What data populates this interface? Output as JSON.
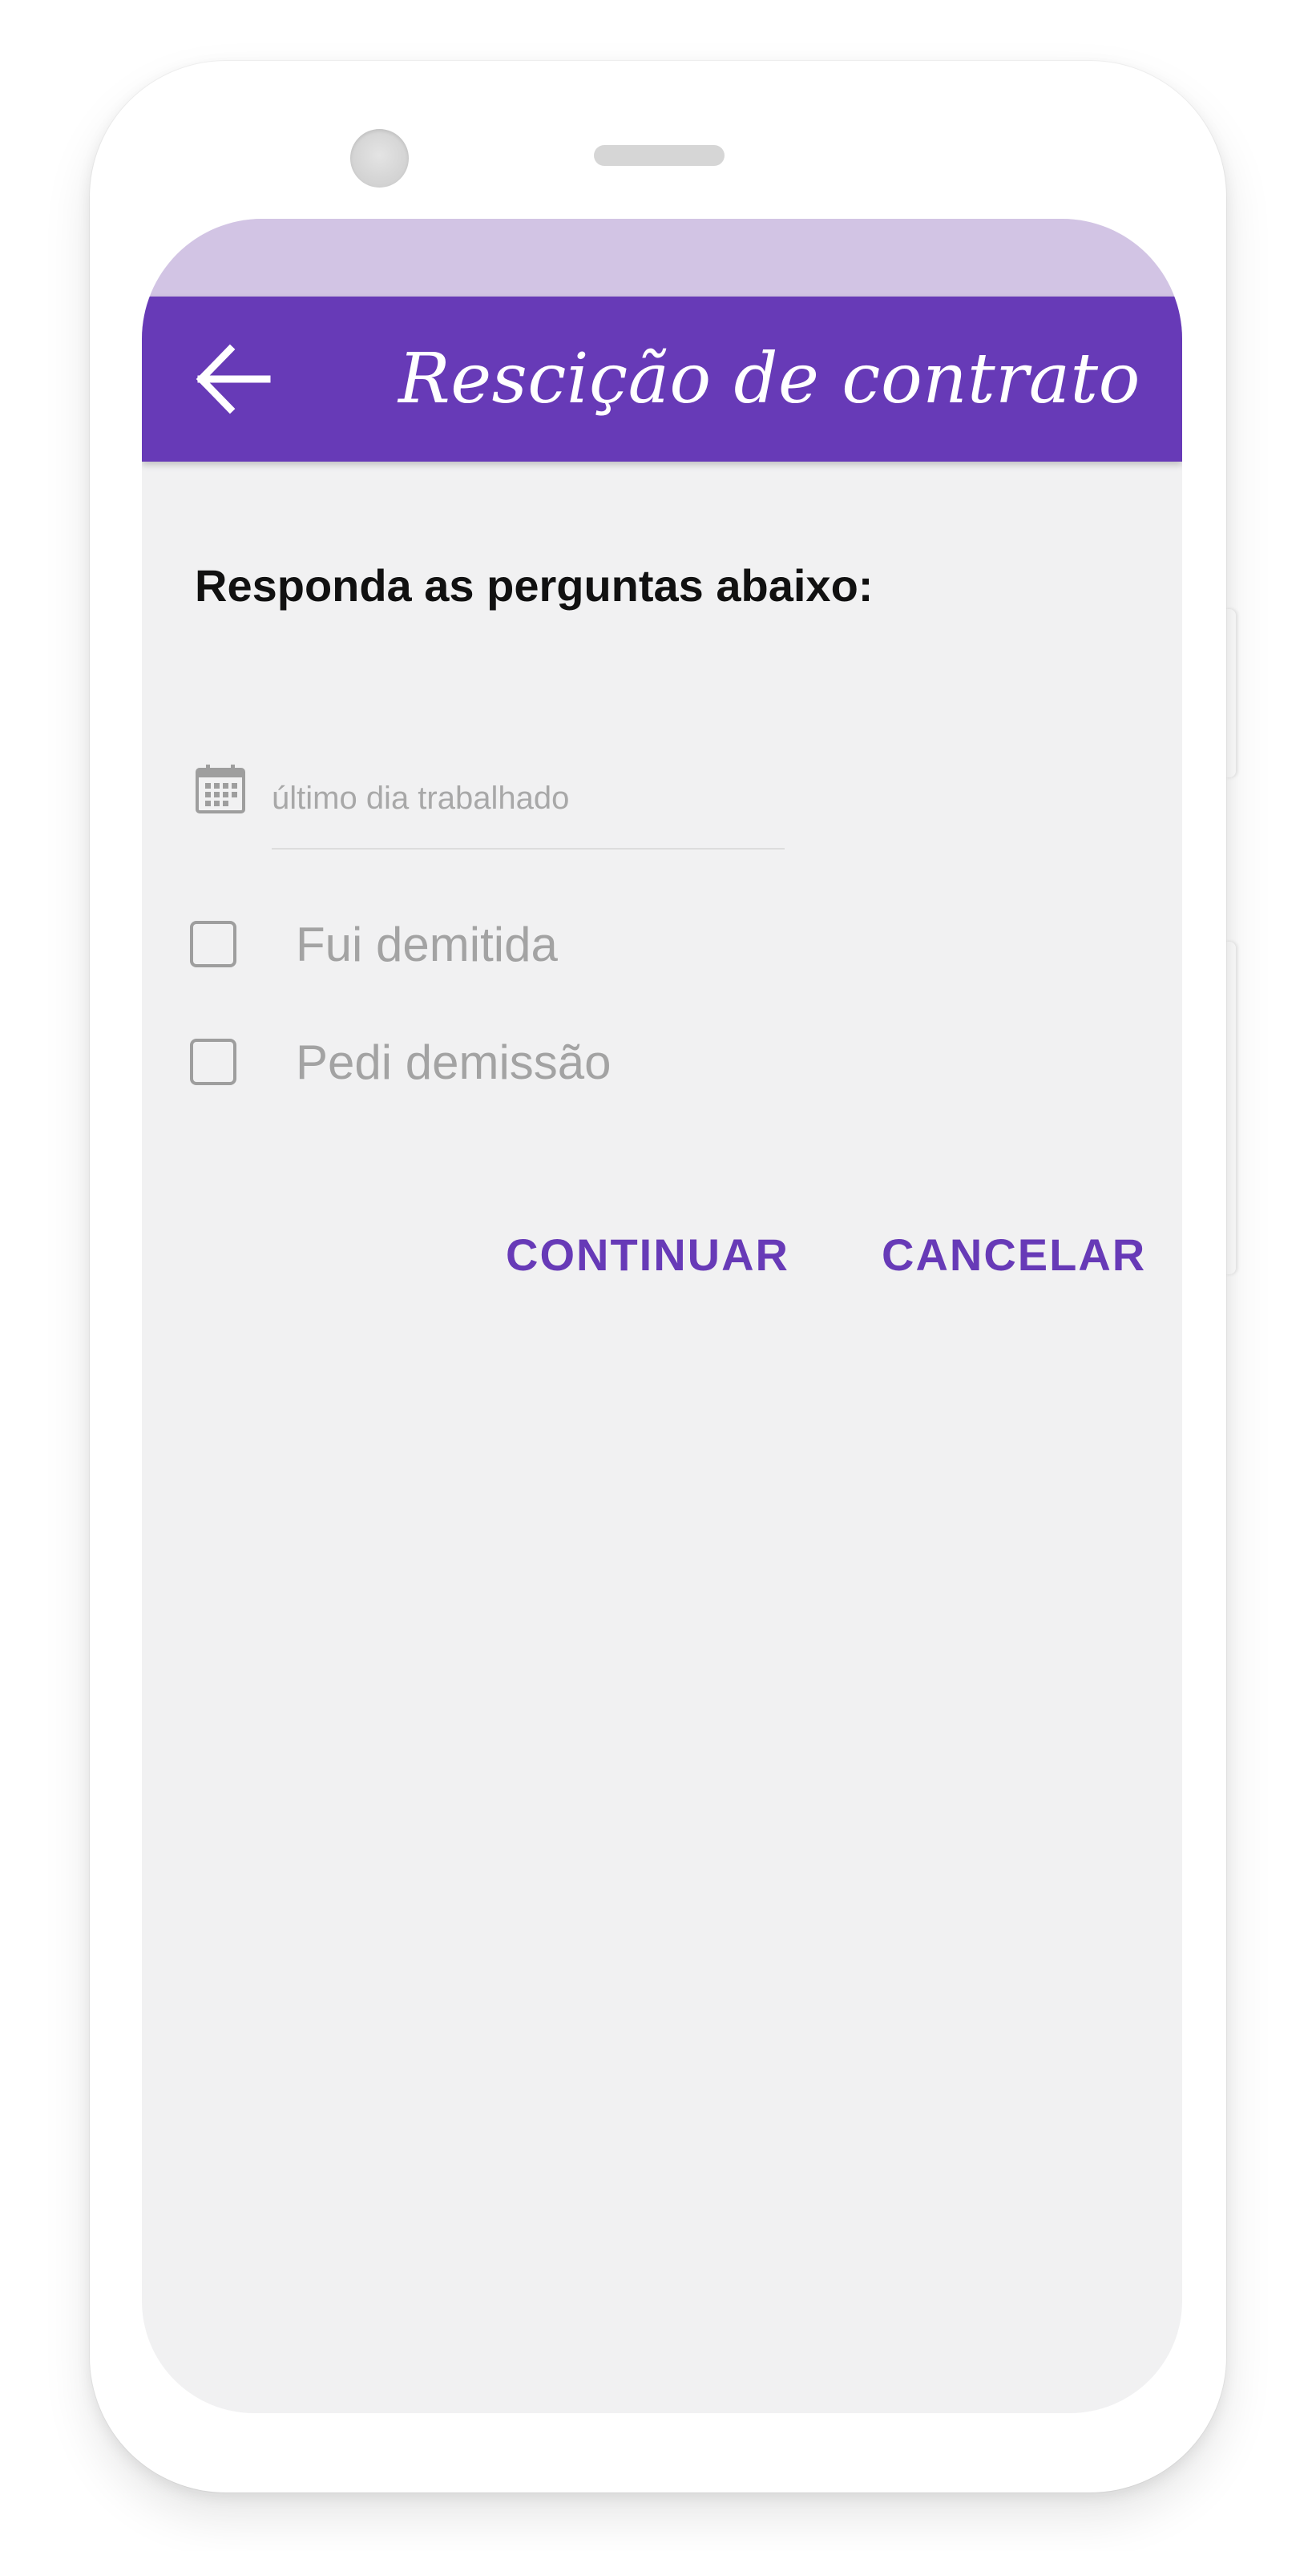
{
  "app_bar": {
    "title": "Rescição de contrato",
    "back_icon": "arrow-back-icon",
    "color": "#673ab7"
  },
  "status_bar": {
    "color": "#d2c4e4"
  },
  "form": {
    "prompt": "Responda as perguntas abaixo:",
    "date_field": {
      "icon": "calendar-icon",
      "placeholder": "último dia trabalhado",
      "value": ""
    },
    "options": [
      {
        "label": "Fui demitida",
        "checked": false
      },
      {
        "label": "Pedi demissão",
        "checked": false
      }
    ]
  },
  "actions": {
    "continue_label": "CONTINUAR",
    "cancel_label": "CANCELAR",
    "accent": "#673ab7"
  }
}
